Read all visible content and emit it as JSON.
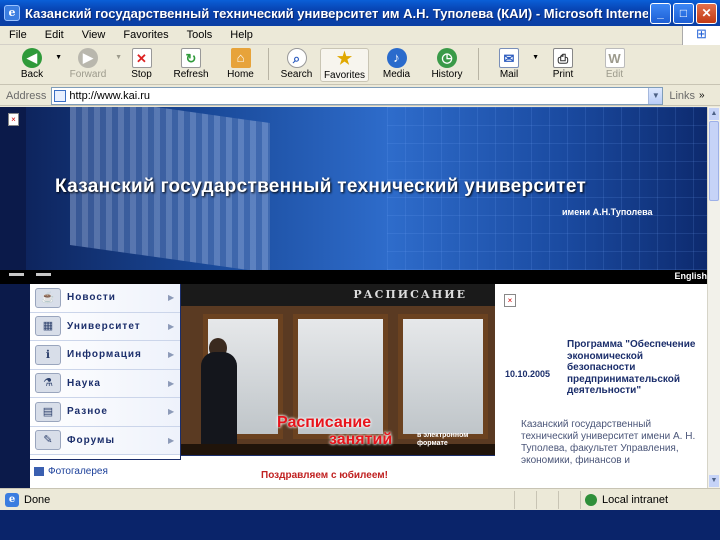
{
  "window": {
    "title": "Казанский государственный технический университет им А.Н. Туполева (КАИ) - Microsoft Internet Explorer",
    "controls": {
      "minimize": "_",
      "maximize": "□",
      "close": "✕"
    }
  },
  "menu": [
    "File",
    "Edit",
    "View",
    "Favorites",
    "Tools",
    "Help"
  ],
  "toolbar": {
    "back": "Back",
    "forward": "Forward",
    "stop": "Stop",
    "refresh": "Refresh",
    "home": "Home",
    "search": "Search",
    "favorites": "Favorites",
    "media": "Media",
    "history": "History",
    "mail": "Mail",
    "print": "Print",
    "edit": "Edit"
  },
  "address": {
    "label": "Address",
    "url": "http://www.kai.ru",
    "links": "Links"
  },
  "site": {
    "banner_title": "Казанский государственный технический университет",
    "banner_subtitle": "имени А.Н.Туполева",
    "language": "English",
    "menu_items": [
      {
        "label": "Новости",
        "icon": "newspaper-icon"
      },
      {
        "label": "Университет",
        "icon": "building-icon"
      },
      {
        "label": "Информация",
        "icon": "info-icon"
      },
      {
        "label": "Наука",
        "icon": "microscope-icon"
      },
      {
        "label": "Разное",
        "icon": "folder-icon"
      },
      {
        "label": "Форумы",
        "icon": "forum-icon"
      }
    ],
    "photo_gallery_link": "Фотогалерея",
    "photo_sign": "РАСПИСАНИЕ",
    "schedule_caption_1": "Расписание",
    "schedule_caption_2": "занятий",
    "schedule_caption_3": "в электронном формате",
    "greeting": "Поздравляем с юбилеем!",
    "news": {
      "date": "10.10.2005",
      "headline": "Программа \"Обеспечение экономической безопасности предпринимательской деятельности\"",
      "description": "Казанский государственный технический университет имени А. Н. Туполева, факультет Управления, экономики, финансов и"
    }
  },
  "status": {
    "text": "Done",
    "zone": "Local intranet"
  },
  "colors": {
    "titlebar": "#0a5fd8",
    "site_navy": "#1b2e6b",
    "accent_red": "#e8141c"
  }
}
